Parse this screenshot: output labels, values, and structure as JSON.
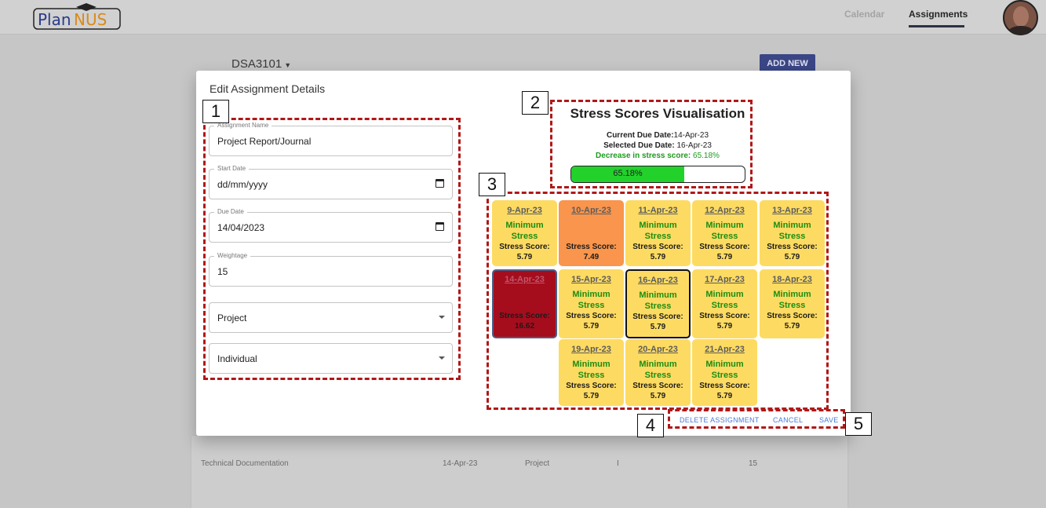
{
  "app": {
    "logo_text": "PlanNUS",
    "nav": {
      "calendar": "Calendar",
      "assignments": "Assignments"
    }
  },
  "page": {
    "course": "DSA3101",
    "add_new_label": "ADD NEW",
    "bg_row": {
      "name": "Technical Documentation",
      "due": "14-Apr-23",
      "type": "Project",
      "mode": "I",
      "weightage": "15"
    }
  },
  "dialog": {
    "title": "Edit Assignment Details",
    "fields": {
      "name_label": "Assignment Name",
      "name_value": "Project Report/Journal",
      "start_label": "Start Date",
      "start_value": "dd/mm/yyyy",
      "due_label": "Due Date",
      "due_value": "14/04/2023",
      "weightage_label": "Weightage",
      "weightage_value": "15",
      "type_value": "Project",
      "mode_value": "Individual"
    },
    "stress": {
      "title": "Stress Scores Visualisation",
      "current_label": "Current Due Date:",
      "current_value": "14-Apr-23",
      "selected_label": "Selected Due Date:",
      "selected_value": " 16-Apr-23",
      "decrease_label": "Decrease in stress score:",
      "decrease_value": " 65.18%",
      "progress_text": "65.18%",
      "progress_fraction": 0.6518,
      "fill_color": "#22d22b"
    },
    "calendar": [
      {
        "date": "9-Apr-23",
        "min": "Minimum Stress",
        "score_label": "Stress Score:",
        "score": "5.79",
        "style": "yellow"
      },
      {
        "date": "10-Apr-23",
        "min": "",
        "score_label": "Stress Score:",
        "score": "7.49",
        "style": "orange"
      },
      {
        "date": "11-Apr-23",
        "min": "Minimum Stress",
        "score_label": "Stress Score:",
        "score": "5.79",
        "style": "yellow"
      },
      {
        "date": "12-Apr-23",
        "min": "Minimum Stress",
        "score_label": "Stress Score:",
        "score": "5.79",
        "style": "yellow"
      },
      {
        "date": "13-Apr-23",
        "min": "Minimum Stress",
        "score_label": "Stress Score:",
        "score": "5.79",
        "style": "yellow"
      },
      {
        "date": "14-Apr-23",
        "min": "",
        "score_label": "Stress Score:",
        "score": "16.62",
        "style": "red"
      },
      {
        "date": "15-Apr-23",
        "min": "Minimum Stress",
        "score_label": "Stress Score:",
        "score": "5.79",
        "style": "yellow"
      },
      {
        "date": "16-Apr-23",
        "min": "Minimum Stress",
        "score_label": "Stress Score:",
        "score": "5.79",
        "style": "selected"
      },
      {
        "date": "17-Apr-23",
        "min": "Minimum Stress",
        "score_label": "Stress Score:",
        "score": "5.79",
        "style": "yellow"
      },
      {
        "date": "18-Apr-23",
        "min": "Minimum Stress",
        "score_label": "Stress Score:",
        "score": "5.79",
        "style": "yellow"
      },
      {
        "date": "19-Apr-23",
        "min": "Minimum Stress",
        "score_label": "Stress Score:",
        "score": "5.79",
        "style": "yellow"
      },
      {
        "date": "20-Apr-23",
        "min": "Minimum Stress",
        "score_label": "Stress Score:",
        "score": "5.79",
        "style": "yellow"
      },
      {
        "date": "21-Apr-23",
        "min": "Minimum Stress",
        "score_label": "Stress Score:",
        "score": "5.79",
        "style": "yellow"
      }
    ],
    "actions": {
      "delete": "DELETE ASSIGNMENT",
      "cancel": "CANCEL",
      "save": "SAVE"
    }
  },
  "annotations": [
    "1",
    "2",
    "3",
    "4",
    "5"
  ]
}
